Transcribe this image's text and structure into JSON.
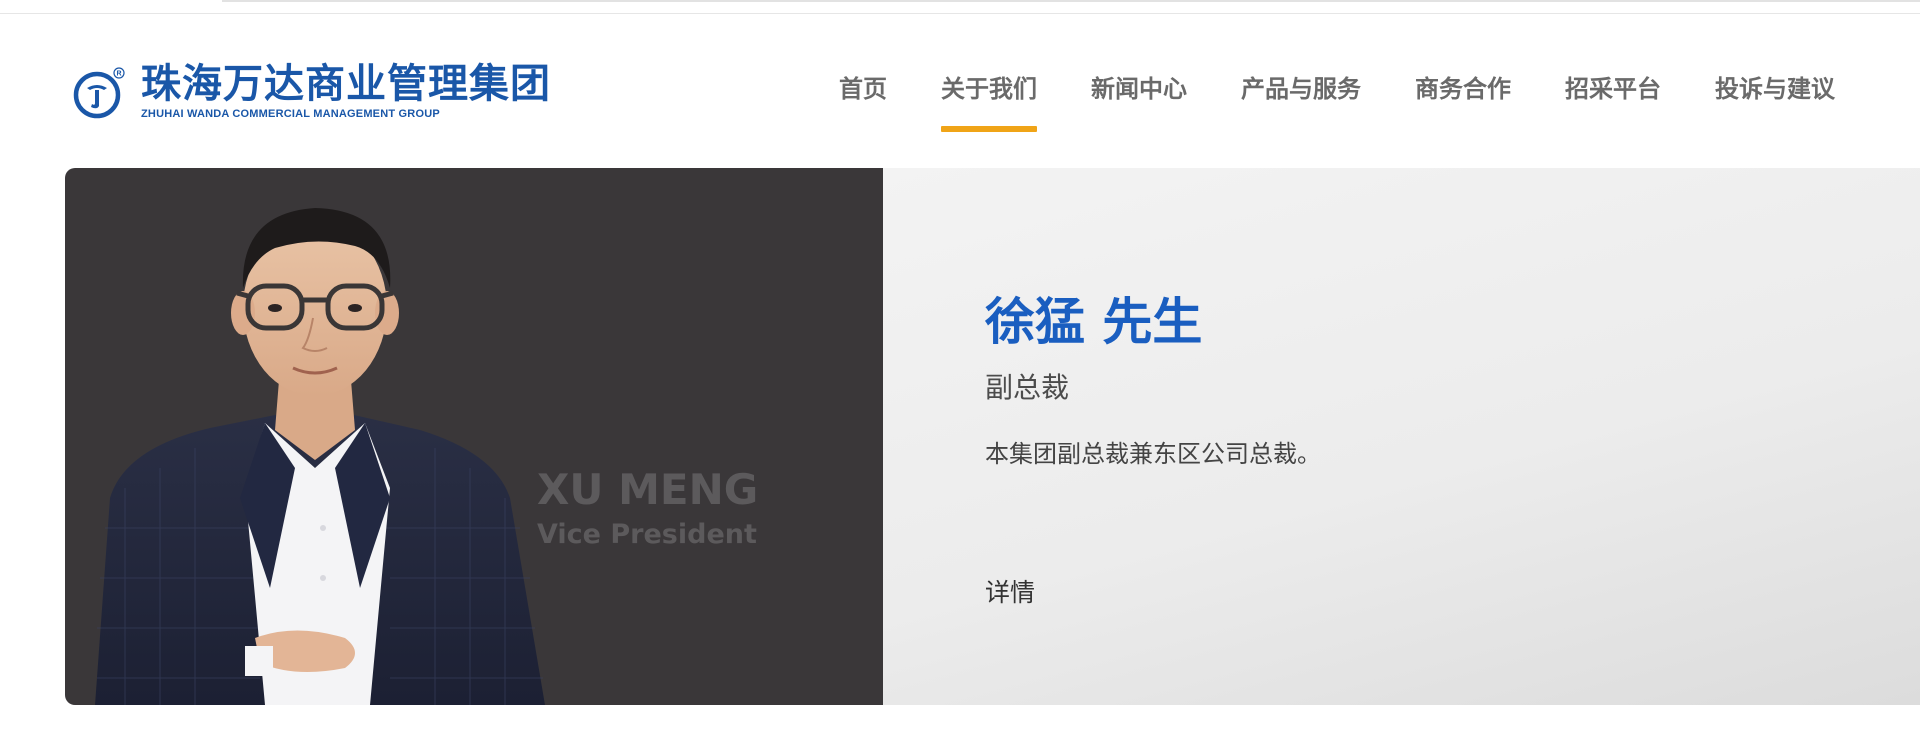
{
  "header": {
    "logo": {
      "name_cn": "珠海万达商业管理集团",
      "name_en": "ZHUHAI WANDA COMMERCIAL MANAGEMENT GROUP",
      "registered_mark": "®",
      "icon": "wanda-logo-icon"
    },
    "nav": {
      "items": [
        {
          "label": "首页",
          "active": false
        },
        {
          "label": "关于我们",
          "active": true
        },
        {
          "label": "新闻中心",
          "active": false
        },
        {
          "label": "产品与服务",
          "active": false
        },
        {
          "label": "商务合作",
          "active": false
        },
        {
          "label": "招采平台",
          "active": false
        },
        {
          "label": "投诉与建议",
          "active": false
        }
      ],
      "active_color": "#f0a417",
      "text_color": "#6a6a6a"
    }
  },
  "profile": {
    "photo_overlay": {
      "name_en": "XU MENG",
      "title_en": "Vice President"
    },
    "name": "徐猛 先生",
    "role": "副总裁",
    "description": "本集团副总裁兼东区公司总裁。",
    "detail_label": "详情",
    "name_color": "#1a5ec0",
    "photo_bg_color": "#3a3739"
  }
}
